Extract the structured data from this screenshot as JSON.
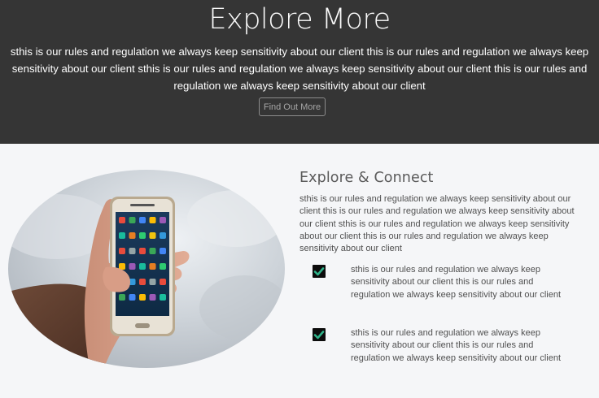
{
  "hero": {
    "title": "Explore More",
    "text": "sthis is our rules and regulation we always keep sensitivity about our client this is our rules and regulation we always keep sensitivity about our client sthis is our rules and regulation we always keep sensitivity about our client this is our rules and regulation we always keep sensitivity about our client",
    "button_label": "Find Out More"
  },
  "explore": {
    "title": "Explore & Connect",
    "text": "sthis is our rules and regulation we always keep sensitivity about our client this is our rules and regulation we always keep sensitivity about our client sthis is our rules and regulation we always keep sensitivity about our client this is our rules and regulation we always keep sensitivity about our client",
    "features": [
      {
        "text": "sthis is our rules and regulation we always keep sensitivity about our client this is our rules and regulation we always keep sensitivity about our client"
      },
      {
        "text": "sthis is our rules and regulation we always keep sensitivity about our client this is our rules and regulation we always keep sensitivity about our client"
      }
    ]
  },
  "colors": {
    "hero_bg": "#353535",
    "content_bg": "#f5f6f8",
    "check_green": "#2fb38a"
  },
  "icons": [
    "checkmark-icon",
    "smartphone-photo"
  ]
}
